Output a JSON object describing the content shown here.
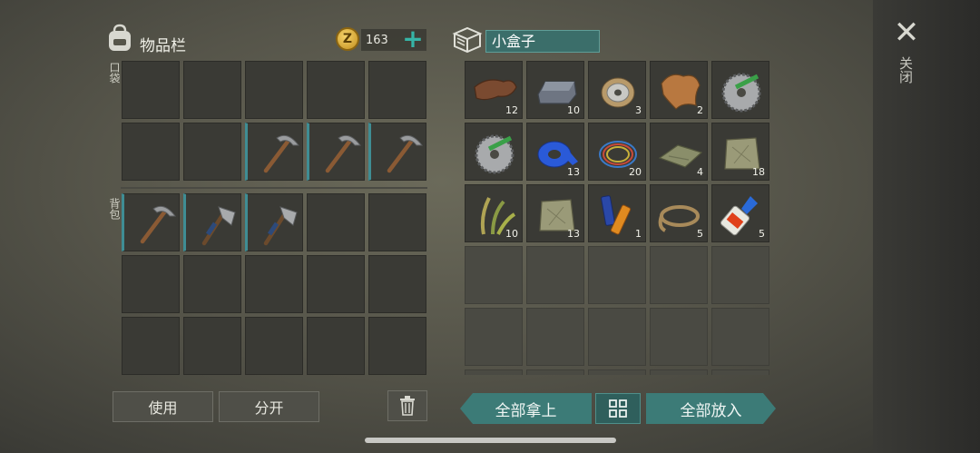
{
  "inventory": {
    "title": "物品栏",
    "coins": "163",
    "coin_symbol": "Z",
    "plus_label": "+",
    "pocket_label": "口袋",
    "backpack_label": "背包",
    "pocket_slots": [
      {
        "item": "",
        "count": ""
      },
      {
        "item": "",
        "count": ""
      },
      {
        "item": "",
        "count": ""
      },
      {
        "item": "",
        "count": ""
      },
      {
        "item": "",
        "count": ""
      },
      {
        "item": "",
        "count": ""
      },
      {
        "item": "",
        "count": ""
      },
      {
        "item": "pickaxe",
        "count": ""
      },
      {
        "item": "pickaxe",
        "count": ""
      },
      {
        "item": "pickaxe",
        "count": ""
      }
    ],
    "backpack_slots": [
      {
        "item": "pickaxe",
        "count": ""
      },
      {
        "item": "hatchet",
        "count": ""
      },
      {
        "item": "hatchet",
        "count": ""
      },
      {
        "item": "",
        "count": ""
      },
      {
        "item": "",
        "count": ""
      },
      {
        "item": "",
        "count": ""
      },
      {
        "item": "",
        "count": ""
      },
      {
        "item": "",
        "count": ""
      },
      {
        "item": "",
        "count": ""
      },
      {
        "item": "",
        "count": ""
      },
      {
        "item": "",
        "count": ""
      },
      {
        "item": "",
        "count": ""
      },
      {
        "item": "",
        "count": ""
      },
      {
        "item": "",
        "count": ""
      },
      {
        "item": "",
        "count": ""
      }
    ]
  },
  "container": {
    "title": "小盒子",
    "slots": [
      {
        "item": "leather",
        "count": "12"
      },
      {
        "item": "iron-ingot",
        "count": "10"
      },
      {
        "item": "wire-spool",
        "count": "3"
      },
      {
        "item": "fur",
        "count": "2"
      },
      {
        "item": "saw-blade",
        "count": ""
      },
      {
        "item": "saw-blade",
        "count": ""
      },
      {
        "item": "tape",
        "count": "13"
      },
      {
        "item": "cable",
        "count": "20"
      },
      {
        "item": "cloth",
        "count": "4"
      },
      {
        "item": "sack",
        "count": "18"
      },
      {
        "item": "plant-fiber",
        "count": "10"
      },
      {
        "item": "sack",
        "count": "13"
      },
      {
        "item": "battery",
        "count": "1"
      },
      {
        "item": "rope",
        "count": "5"
      },
      {
        "item": "glue",
        "count": "5"
      }
    ],
    "empty_rows": 3
  },
  "actions": {
    "use_label": "使用",
    "split_label": "分开",
    "take_all_label": "全部拿上",
    "put_all_label": "全部放入",
    "close_label": "关闭",
    "close_symbol": "✕"
  },
  "colors": {
    "accent": "#3c7b77",
    "equipped_marker": "#3f8d94"
  }
}
